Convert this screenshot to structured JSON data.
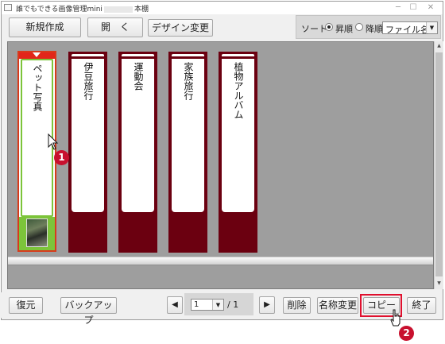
{
  "window": {
    "title": "誰でもできる画像管理mini",
    "title_suffix": "本棚"
  },
  "toolbar": {
    "new_label": "新規作成",
    "open_label": "開　く",
    "design_label": "デザイン変更"
  },
  "sort": {
    "label": "ソート",
    "asc_label": "昇順",
    "desc_label": "降順",
    "selected_order": "asc",
    "field_value": "ファイル名"
  },
  "binders": [
    {
      "label": "ペット写真",
      "selected": true,
      "has_thumbnail": true
    },
    {
      "label": "伊豆旅行",
      "selected": false
    },
    {
      "label": "運動会",
      "selected": false
    },
    {
      "label": "家族旅行",
      "selected": false
    },
    {
      "label": "植物アルバム",
      "selected": false
    }
  ],
  "bottom": {
    "restore_label": "復元",
    "backup_label": "バックアップ",
    "page_value": "1",
    "page_total": "/ 1",
    "delete_label": "削除",
    "rename_label": "名称変更",
    "copy_label": "コピー",
    "exit_label": "終了"
  },
  "annotations": {
    "step1": "1",
    "step2": "2"
  },
  "colors": {
    "binder": "#6b0010",
    "selected_border": "#d83a1c",
    "selected_accent": "#7cc43a",
    "highlight_box": "#e0102e"
  }
}
